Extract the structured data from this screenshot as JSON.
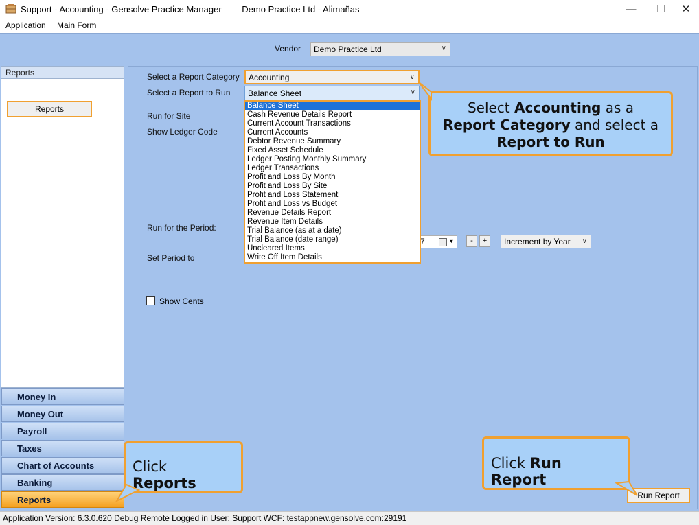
{
  "window": {
    "title_parts": [
      "Support - Accounting - Gensolve Practice Manager",
      "Demo Practice Ltd - Alimañas"
    ]
  },
  "menu": {
    "items": [
      "Application",
      "Main Form"
    ]
  },
  "vendor": {
    "label": "Vendor",
    "value": "Demo Practice Ltd"
  },
  "left_panel": {
    "header": "Reports",
    "button": "Reports"
  },
  "nav": {
    "items": [
      "Money In",
      "Money Out",
      "Payroll",
      "Taxes",
      "Chart of Accounts",
      "Banking",
      "Reports"
    ],
    "active": "Reports"
  },
  "form": {
    "category_label": "Select a Report Category",
    "category_value": "Accounting",
    "report_label": "Select a Report to Run",
    "report_value": "Balance Sheet",
    "site_label": "Run for Site",
    "ledger_label": "Show Ledger Code",
    "period_label": "Run for the Period:",
    "set_period_label": "Set Period to",
    "date_fragment": "7",
    "minus": "-",
    "plus": "+",
    "increment_value": "Increment by Year",
    "show_cents": "Show Cents",
    "run_button": "Run Report"
  },
  "report_options": [
    "Balance Sheet",
    "Cash Revenue Details Report",
    "Current Account Transactions",
    "Current Accounts",
    "Debtor Revenue Summary",
    "Fixed Asset Schedule",
    "Ledger Posting Monthly Summary",
    "Ledger Transactions",
    "Profit and Loss By Month",
    "Profit and Loss By Site",
    "Profit and Loss Statement",
    "Profit and Loss vs Budget",
    "Revenue Details Report",
    "Revenue Item Details",
    "Trial Balance (as at a date)",
    "Trial Balance (date range)",
    "Uncleared Items",
    "Write Off Item Details"
  ],
  "selected_report_index": 0,
  "callouts": {
    "select": {
      "t1": "Select ",
      "b1": "Accounting",
      "t2": " as a",
      "b2": "Report Category",
      "t3": " and select a",
      "b3": "Report to Run"
    },
    "reports": {
      "t1": "Click ",
      "b1": "Reports"
    },
    "run": {
      "t1": "Click ",
      "b1": "Run Report"
    }
  },
  "status": "Application Version: 6.3.0.620 Debug Remote  Logged in User: Support WCF: testappnew.gensolve.com:29191",
  "colors": {
    "accent": "#f0a030",
    "selection": "#1e72d6",
    "panel": "#a4c2ec",
    "callout": "#a8d0f8"
  }
}
